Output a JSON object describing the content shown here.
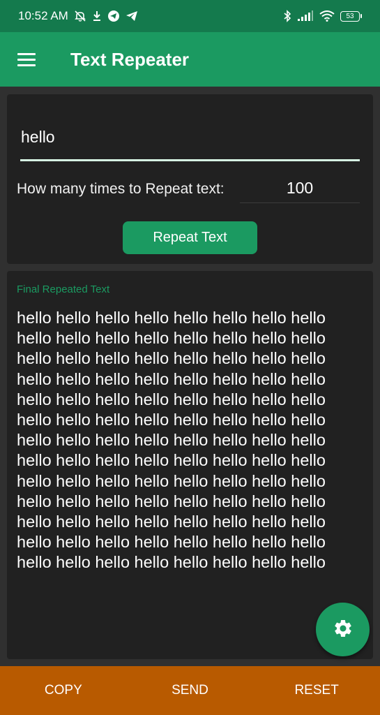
{
  "status_bar": {
    "time": "10:52 AM",
    "battery": "53"
  },
  "app_bar": {
    "title": "Text Repeater"
  },
  "input_card": {
    "text_value": "hello",
    "repeat_label": "How many times to Repeat text:",
    "count_value": "100",
    "repeat_button_label": "Repeat Text"
  },
  "output_card": {
    "label": "Final Repeated Text",
    "repeated_text": "hello hello hello hello hello hello hello hello hello hello hello hello hello hello hello hello hello hello hello hello hello hello hello hello hello hello hello hello hello hello hello hello hello hello hello hello hello hello hello hello hello hello hello hello hello hello hello hello hello hello hello hello hello hello hello hello hello hello hello hello hello hello hello hello hello hello hello hello hello hello hello hello hello hello hello hello hello hello hello hello hello hello hello hello hello hello hello hello hello hello hello hello hello hello hello hello hello hello hello hello hello hello hello hello"
  },
  "actions": {
    "copy_label": "COPY",
    "send_label": "SEND",
    "reset_label": "RESET"
  },
  "icons": {
    "menu": "menu-icon",
    "settings": "gear-icon",
    "mute": "mute-icon",
    "download": "download-icon",
    "telegram": "telegram-icon",
    "bluetooth": "bluetooth-icon",
    "signal": "signal-icon",
    "wifi": "wifi-icon",
    "battery": "battery-icon"
  },
  "colors": {
    "status_bar": "#147a4d",
    "app_bar": "#1b9a61",
    "accent": "#1b9a61",
    "card": "#212121",
    "background": "#303030",
    "action_bar": "#b85a00"
  }
}
